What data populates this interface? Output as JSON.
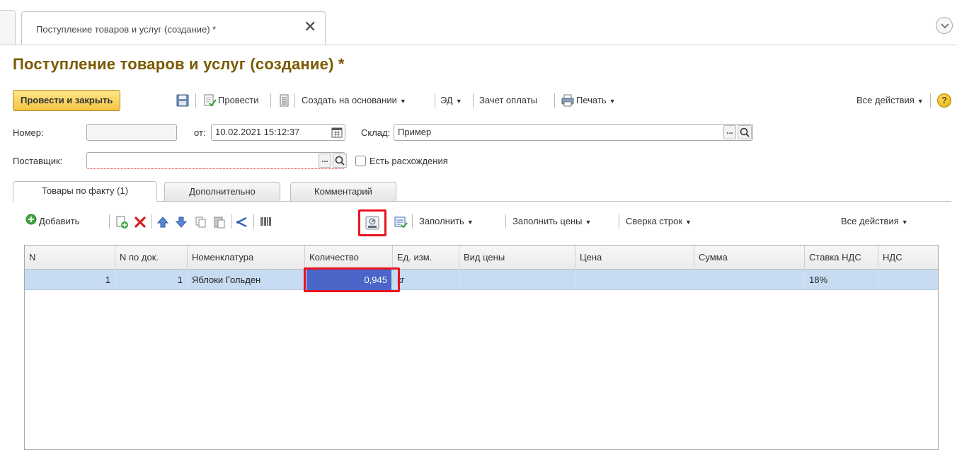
{
  "window_tab": {
    "label": "Поступление товаров и услуг (создание) *"
  },
  "page": {
    "title": "Поступление товаров и услуг (создание) *"
  },
  "toolbar": {
    "post_and_close": "Провести и закрыть",
    "post": "Провести",
    "create_based": "Создать на основании",
    "ed": "ЭД",
    "payment_offset": "Зачет оплаты",
    "print": "Печать",
    "all_actions": "Все действия",
    "help": "?"
  },
  "fields": {
    "number_label": "Номер:",
    "number_value": "",
    "from_label": "от:",
    "date_value": "10.02.2021 15:12:37",
    "warehouse_label": "Склад:",
    "warehouse_value": "Пример",
    "supplier_label": "Поставщик:",
    "supplier_value": "",
    "discrepancy_label": "Есть расхождения",
    "ellipsis": "..."
  },
  "tabs": [
    {
      "label": "Товары по факту (1)",
      "active": true
    },
    {
      "label": "Дополнительно"
    },
    {
      "label": "Комментарий"
    }
  ],
  "table_toolbar": {
    "add": "Добавить",
    "fill": "Заполнить",
    "fill_prices": "Заполнить цены",
    "reconcile_rows": "Сверка строк",
    "all_actions": "Все действия"
  },
  "table": {
    "columns": [
      "N",
      "N по док.",
      "Номенклатура",
      "Количество",
      "Ед. изм.",
      "Вид цены",
      "Цена",
      "Сумма",
      "Ставка НДС",
      "НДС"
    ],
    "rows": [
      {
        "n": "1",
        "n_doc": "1",
        "item": "Яблоки Гольден",
        "qty": "0,945",
        "unit": "кг",
        "price_type": "",
        "price": "",
        "sum": "",
        "vat_rate": "18%",
        "vat": ""
      }
    ]
  },
  "colors": {
    "title": "#7a5a00",
    "primary_button": "#f4c542",
    "selected_row": "#c7dcf2",
    "selected_cell": "#4a64c8",
    "highlight": "#e8141f"
  }
}
